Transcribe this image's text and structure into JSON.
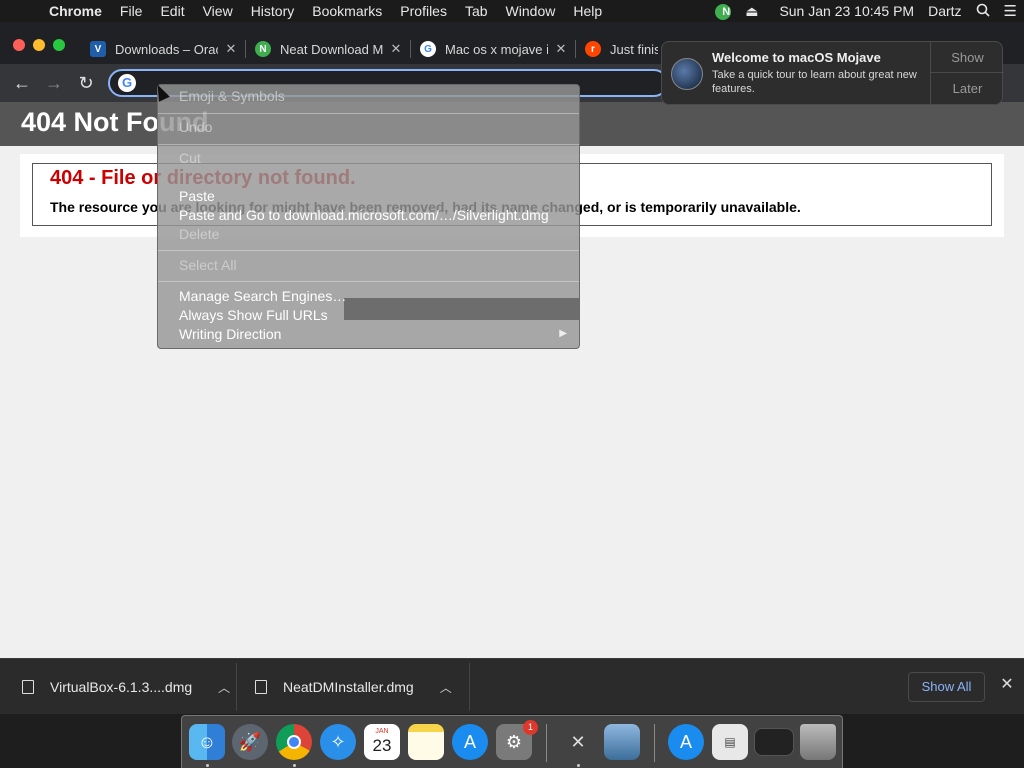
{
  "menubar": {
    "app": "Chrome",
    "items": [
      "File",
      "Edit",
      "View",
      "History",
      "Bookmarks",
      "Profiles",
      "Tab",
      "Window",
      "Help"
    ],
    "status_app_badge": "N",
    "clock": "Sun Jan 23  10:45 PM",
    "user": "Dartz"
  },
  "tabs": [
    {
      "title": "Downloads – Orac",
      "icon": "virtualbox-icon",
      "color": "#1f5ea8"
    },
    {
      "title": "Neat Download M",
      "icon": "neat-download-icon",
      "color": "#3fae4f"
    },
    {
      "title": "Mac os x mojave i",
      "icon": "google-icon",
      "color": "#ffffff"
    },
    {
      "title": "Just finis",
      "icon": "reddit-icon",
      "color": "#ff4500"
    }
  ],
  "page": {
    "header": "404 Not Found",
    "error_title": "404 - File or directory not found.",
    "error_desc": "The resource you are looking for might have been removed, had its name changed, or is temporarily unavailable."
  },
  "context_menu": {
    "emoji": "Emoji & Symbols",
    "undo": "Undo",
    "cut": "Cut",
    "paste": "Paste",
    "paste_go": "Paste and Go to download.microsoft.com/…/Silverlight.dmg",
    "delete": "Delete",
    "select_all": "Select All",
    "manage_search": "Manage Search Engines…",
    "show_urls": "Always Show Full URLs",
    "writing_direction": "Writing Direction"
  },
  "notification": {
    "title": "Welcome to macOS Mojave",
    "body": "Take a quick tour to learn about great new features.",
    "show": "Show",
    "later": "Later"
  },
  "downloads": {
    "items": [
      "VirtualBox-6.1.3....dmg",
      "NeatDMInstaller.dmg"
    ],
    "show_all": "Show All"
  },
  "dock": {
    "calendar_month": "JAN",
    "calendar_day": "23",
    "settings_badge": "1"
  },
  "colors": {
    "accent": "#8ab4f8",
    "error_red": "#cc0000",
    "page_header_bg": "#555555"
  }
}
